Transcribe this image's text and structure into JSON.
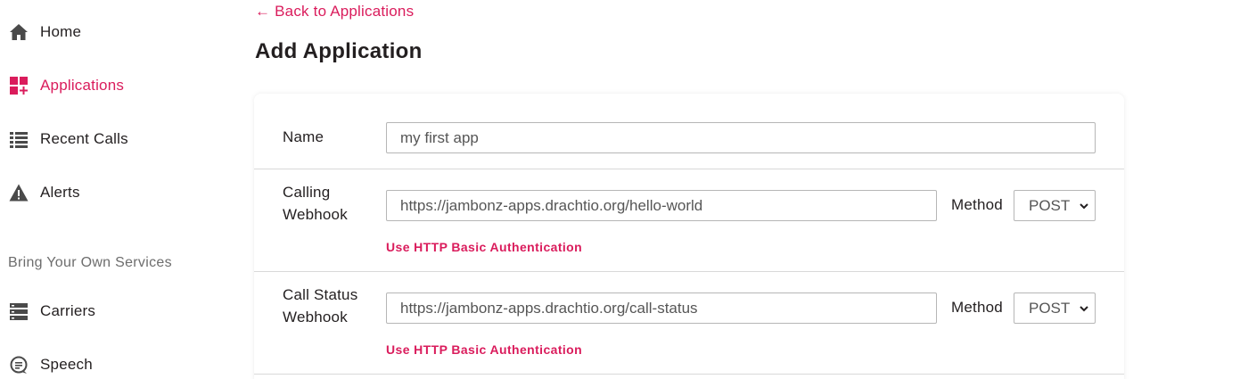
{
  "sidebar": {
    "items": [
      {
        "label": "Home",
        "icon": "home-icon"
      },
      {
        "label": "Applications",
        "icon": "applications-icon",
        "active": true
      },
      {
        "label": "Recent Calls",
        "icon": "list-icon"
      },
      {
        "label": "Alerts",
        "icon": "alert-icon"
      }
    ],
    "section_label": "Bring Your Own Services",
    "section_items": [
      {
        "label": "Carriers",
        "icon": "carriers-icon"
      },
      {
        "label": "Speech",
        "icon": "speech-icon"
      }
    ]
  },
  "main": {
    "back_link": "← Back to Applications",
    "title": "Add Application",
    "form": {
      "name": {
        "label": "Name",
        "value": "my first app"
      },
      "calling_webhook": {
        "label_line1": "Calling",
        "label_line2": "Webhook",
        "value": "https://jambonz-apps.drachtio.org/hello-world",
        "method_label": "Method",
        "method_value": "POST",
        "auth_link": "Use HTTP Basic Authentication"
      },
      "call_status_webhook": {
        "label_line1": "Call Status",
        "label_line2": "Webhook",
        "value": "https://jambonz-apps.drachtio.org/call-status",
        "method_label": "Method",
        "method_value": "POST",
        "auth_link": "Use HTTP Basic Authentication"
      }
    }
  },
  "colors": {
    "accent": "#da1c5c",
    "text": "#231f20",
    "muted": "#6d6d6d",
    "border": "#b6b6b6"
  }
}
